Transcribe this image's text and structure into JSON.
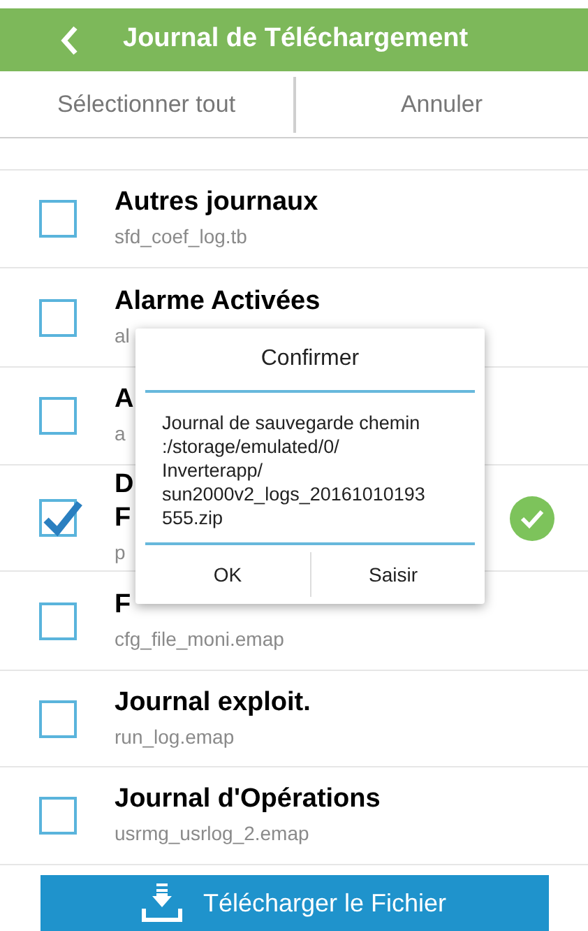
{
  "title_bar": {
    "title": "Journal de Téléchargement"
  },
  "toolbar": {
    "select_all": "Sélectionner tout",
    "cancel": "Annuler"
  },
  "files": [
    {
      "title_lines": [
        "Autres journaux"
      ],
      "file": "sfd_coef_log.tb",
      "checked": false,
      "done": false
    },
    {
      "title_lines": [
        "Alarme Activées"
      ],
      "file": "al",
      "checked": false,
      "done": false
    },
    {
      "title_lines": [
        "A"
      ],
      "file": "a",
      "checked": false,
      "done": false
    },
    {
      "title_lines": [
        "D",
        "F"
      ],
      "file": "p",
      "checked": true,
      "done": true
    },
    {
      "title_lines": [
        "F"
      ],
      "file": "cfg_file_moni.emap",
      "checked": false,
      "done": false
    },
    {
      "title_lines": [
        "Journal exploit."
      ],
      "file": "run_log.emap",
      "checked": false,
      "done": false
    },
    {
      "title_lines": [
        "Journal d'Opérations"
      ],
      "file": "usrmg_usrlog_2.emap",
      "checked": false,
      "done": false
    }
  ],
  "dialog": {
    "title": "Confirmer",
    "message": "Journal de sauvegarde chemin\n:/storage/emulated/0/\nInverterapp/\nsun2000v2_logs_20161010193\n555.zip",
    "buttons": [
      "OK",
      "Saisir"
    ]
  },
  "download_button": "Télécharger le Fichier"
}
